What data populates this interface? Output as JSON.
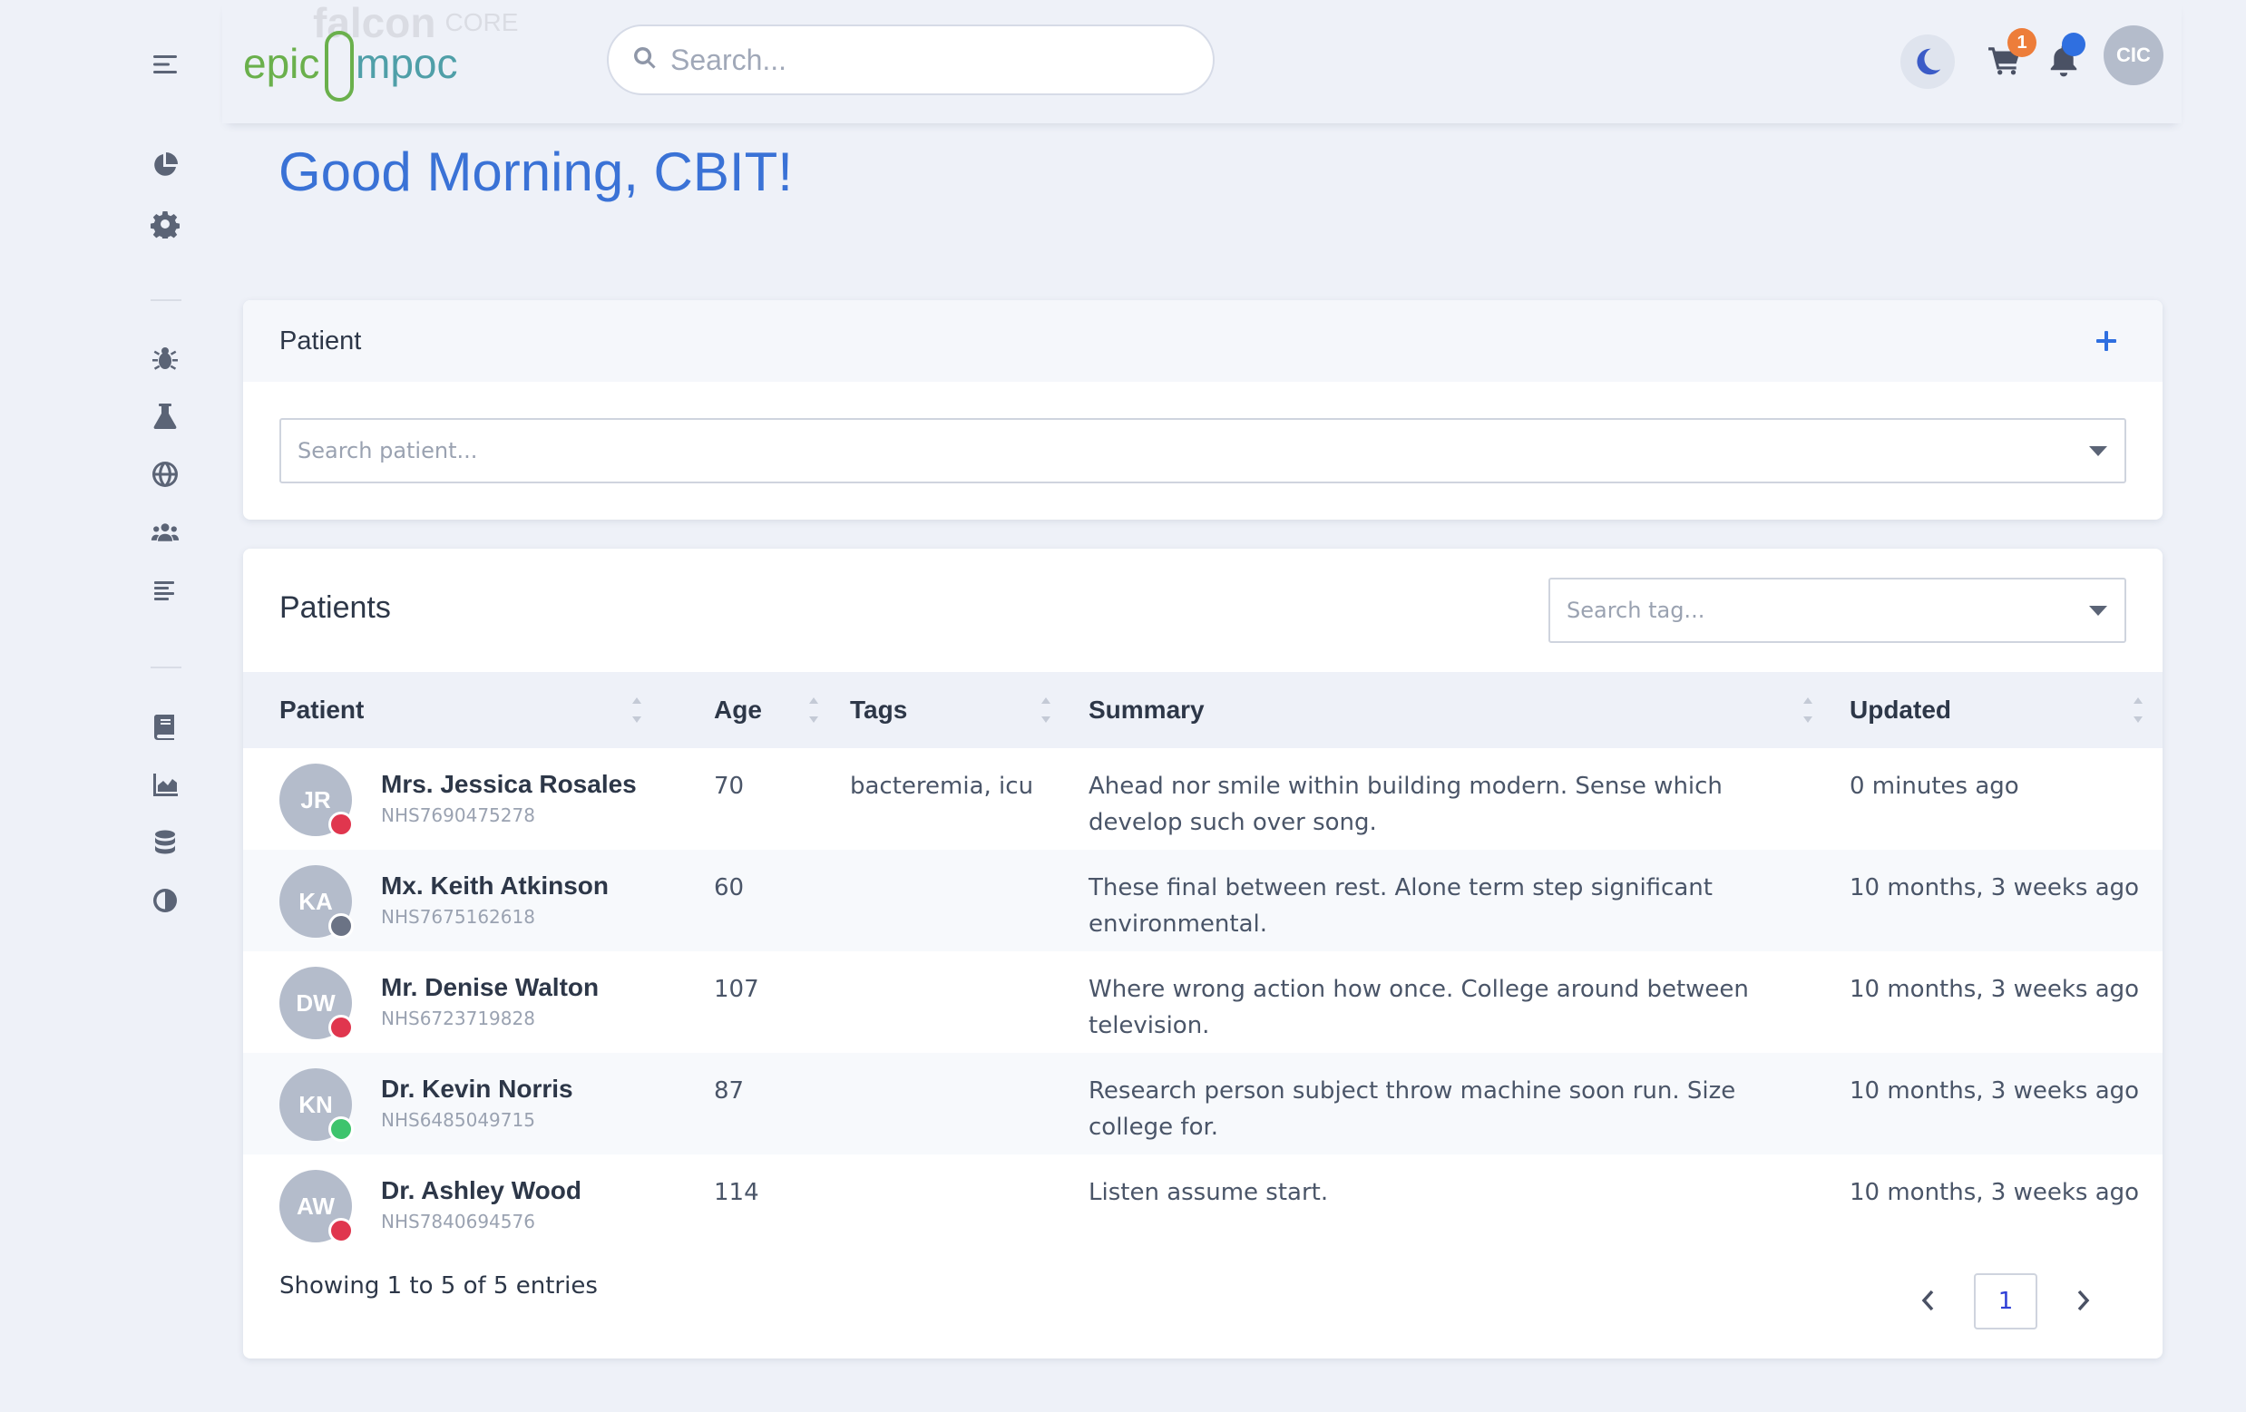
{
  "sidebar": {
    "menu_icon": "hamburger-menu-icon",
    "items": [
      {
        "icon": "pie-chart-icon",
        "name": "sidebar-item-dashboard"
      },
      {
        "icon": "gear-icon",
        "name": "sidebar-item-settings"
      },
      {
        "icon": "bug-icon",
        "name": "sidebar-item-bugs"
      },
      {
        "icon": "flask-icon",
        "name": "sidebar-item-lab"
      },
      {
        "icon": "globe-icon",
        "name": "sidebar-item-global"
      },
      {
        "icon": "users-icon",
        "name": "sidebar-item-users"
      },
      {
        "icon": "align-left-icon",
        "name": "sidebar-item-reports"
      },
      {
        "icon": "book-icon",
        "name": "sidebar-item-docs"
      },
      {
        "icon": "area-chart-icon",
        "name": "sidebar-item-analytics"
      },
      {
        "icon": "database-icon",
        "name": "sidebar-item-database"
      },
      {
        "icon": "contrast-icon",
        "name": "sidebar-item-theme"
      }
    ]
  },
  "header": {
    "logo_text": "epicimpoc",
    "ghost_logo_text": "falcon",
    "ghost_logo_sub": "CORE",
    "search_placeholder": "Search...",
    "cart_count": "1",
    "user_initials": "CIC",
    "colors": {
      "brand_green": "#6ab04c",
      "accent_blue": "#2f6fe0",
      "cart_badge": "#ed7d3a"
    }
  },
  "greeting": "Good Morning, CBIT!",
  "patient_card": {
    "title": "Patient",
    "search_placeholder": "Search patient..."
  },
  "patients_table": {
    "title": "Patients",
    "tag_placeholder": "Search tag...",
    "columns": [
      "Patient",
      "Age",
      "Tags",
      "Summary",
      "Updated"
    ],
    "rows": [
      {
        "initials": "JR",
        "name": "Mrs. Jessica Rosales",
        "nhs": "NHS7690475278",
        "age": "70",
        "tags": "bacteremia, icu",
        "summary": "Ahead nor smile within building modern. Sense which develop such over song.",
        "updated": "0 minutes ago",
        "status_color": "#e0364e"
      },
      {
        "initials": "KA",
        "name": "Mx. Keith Atkinson",
        "nhs": "NHS7675162618",
        "age": "60",
        "tags": "",
        "summary": "These final between rest. Alone term step significant environmental.",
        "updated": "10 months, 3 weeks ago",
        "status_color": "#6b7385"
      },
      {
        "initials": "DW",
        "name": "Mr. Denise Walton",
        "nhs": "NHS6723719828",
        "age": "107",
        "tags": "",
        "summary": "Where wrong action how once. College around between television.",
        "updated": "10 months, 3 weeks ago",
        "status_color": "#e0364e"
      },
      {
        "initials": "KN",
        "name": "Dr. Kevin Norris",
        "nhs": "NHS6485049715",
        "age": "87",
        "tags": "",
        "summary": "Research person subject throw machine soon run. Size college for.",
        "updated": "10 months, 3 weeks ago",
        "status_color": "#3ec46d"
      },
      {
        "initials": "AW",
        "name": "Dr. Ashley Wood",
        "nhs": "NHS7840694576",
        "age": "114",
        "tags": "",
        "summary": "Listen assume start.",
        "updated": "10 months, 3 weeks ago",
        "status_color": "#e0364e"
      }
    ],
    "footer_info": "Showing 1 to 5 of 5 entries",
    "current_page": "1"
  }
}
